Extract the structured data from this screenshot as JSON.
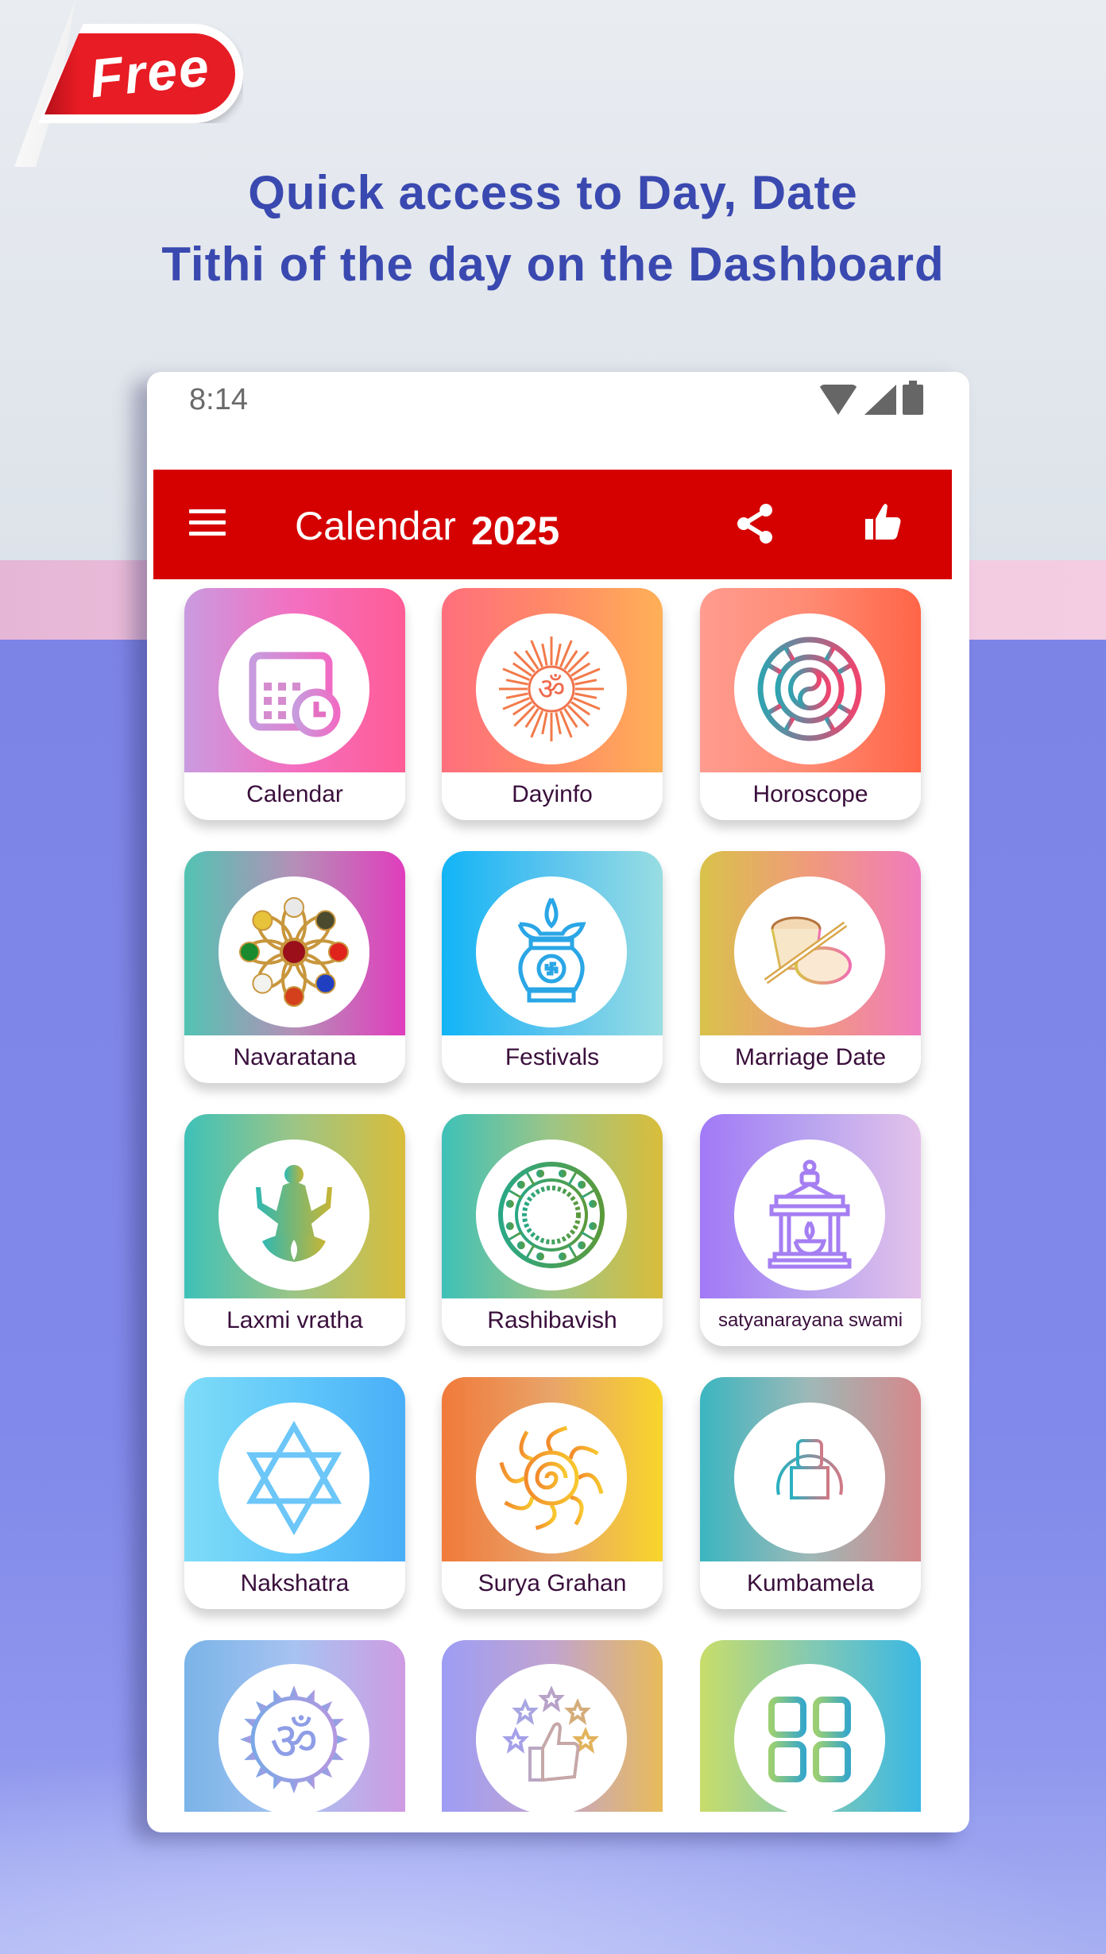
{
  "promo": {
    "badge": "Free",
    "headline_line1": "Quick access to Day, Date",
    "headline_line2": "Tithi of the day on the Dashboard",
    "colors": {
      "headline": "#3a49b0",
      "badge": "#e71d25",
      "band_pink": "#f0c6de",
      "band_blue": "#7c84e6"
    }
  },
  "status_bar": {
    "time": "8:14",
    "icons": [
      "wifi-icon",
      "cellular-signal-icon",
      "battery-icon"
    ]
  },
  "app_bar": {
    "title": "Calendar",
    "year": "2025",
    "color": "#d50000",
    "actions": [
      "menu-icon",
      "share-icon",
      "thumbs-up-icon"
    ]
  },
  "tiles": [
    {
      "label": "Calendar",
      "icon": "calendar-clock-icon",
      "gradient": [
        "#c99be0",
        "#f46fc0",
        "#ff5c95"
      ]
    },
    {
      "label": "Dayinfo",
      "icon": "om-sun-icon",
      "gradient": [
        "#ff6f7d",
        "#ff8a66",
        "#ffb057"
      ]
    },
    {
      "label": "Horoscope",
      "icon": "zodiac-wheel-icon",
      "gradient": [
        "#ff9c90",
        "#ff8a72",
        "#ff6547"
      ]
    },
    {
      "label": "Navaratana",
      "icon": "navaratna-gems-icon",
      "gradient": [
        "#52c3b3",
        "#b58fb7",
        "#e03dbd"
      ]
    },
    {
      "label": "Festivals",
      "icon": "kalash-icon",
      "gradient": [
        "#12b4f6",
        "#5cc4ee",
        "#98dde2"
      ]
    },
    {
      "label": "Marriage Date",
      "icon": "dhol-drum-icon",
      "gradient": [
        "#d9c24a",
        "#f09a7c",
        "#f07bbd"
      ]
    },
    {
      "label": "Laxmi vratha",
      "icon": "lakshmi-icon",
      "gradient": [
        "#3ec1b8",
        "#9dc586",
        "#d9bd3a"
      ]
    },
    {
      "label": "Rashibavish",
      "icon": "rashi-wheel-icon",
      "gradient": [
        "#3ec1b8",
        "#9dc586",
        "#d9bd3a"
      ]
    },
    {
      "label": "satyanarayana swami",
      "icon": "temple-lamp-icon",
      "gradient": [
        "#a179f6",
        "#b9a4ef",
        "#e3c2ea"
      ]
    },
    {
      "label": "Nakshatra",
      "icon": "star-hexagram-icon",
      "gradient": [
        "#7fdcf8",
        "#61c8f9",
        "#4aaef8"
      ]
    },
    {
      "label": "Surya Grahan",
      "icon": "sun-icon",
      "gradient": [
        "#f07a3a",
        "#e8a46a",
        "#f8d52a"
      ]
    },
    {
      "label": "Kumbamela",
      "icon": "kumbh-mela-icon",
      "gradient": [
        "#3bb6c0",
        "#9fb8b7",
        "#d6878a"
      ]
    },
    {
      "label": "",
      "icon": "om-icon",
      "gradient": [
        "#7ab4e8",
        "#a7c3f1",
        "#cf9be3"
      ]
    },
    {
      "label": "",
      "icon": "rating-thumbs-up-icon",
      "gradient": [
        "#9d9df5",
        "#c2a4cf",
        "#e8bb5a"
      ]
    },
    {
      "label": "",
      "icon": "more-apps-grid-icon",
      "gradient": [
        "#c8dd6a",
        "#84c9b2",
        "#3ab8e4"
      ]
    }
  ]
}
